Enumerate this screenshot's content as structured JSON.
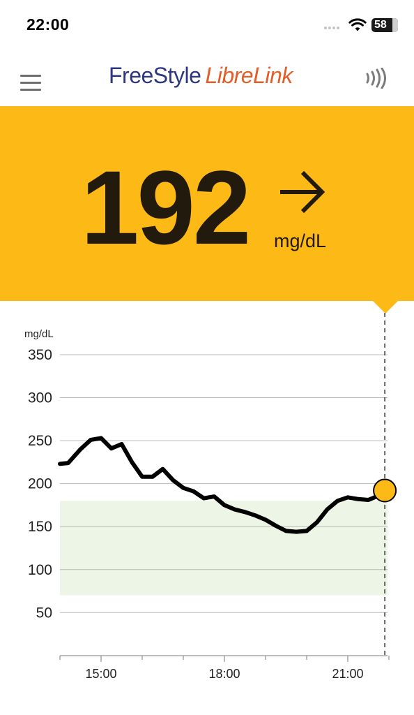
{
  "status_bar": {
    "time": "22:00",
    "battery": "58"
  },
  "header": {
    "brand_part1": "FreeStyle",
    "brand_part2": "LibreLink",
    "menu_icon": "hamburger-menu-icon",
    "scan_icon": "nfc-scan-icon"
  },
  "reading": {
    "value": "192",
    "unit": "mg/dL",
    "trend": "steady-right-arrow",
    "banner_color": "#fdb915"
  },
  "chart_data": {
    "type": "line",
    "ylabel": "mg/dL",
    "ylim": [
      0,
      350
    ],
    "y_ticks": [
      50,
      100,
      150,
      200,
      250,
      300,
      350
    ],
    "x_ticks": [
      "15:00",
      "18:00",
      "21:00"
    ],
    "x_range_hours": [
      14.0,
      22.0
    ],
    "target_range": [
      70,
      180
    ],
    "target_color": "#edf6e6",
    "line_color": "#000000",
    "current_point": {
      "x": 21.9,
      "y": 192,
      "color": "#fdb915"
    },
    "series": [
      {
        "x": [
          14.0,
          14.2,
          14.5,
          14.75,
          15.0,
          15.25,
          15.5,
          15.75,
          16.0,
          16.25,
          16.5,
          16.75,
          17.0,
          17.25,
          17.5,
          17.75,
          18.0,
          18.25,
          18.5,
          18.75,
          19.0,
          19.25,
          19.5,
          19.75,
          20.0,
          20.25,
          20.5,
          20.75,
          21.0,
          21.25,
          21.5,
          21.75,
          21.9
        ],
        "y": [
          223,
          224,
          240,
          251,
          253,
          241,
          246,
          225,
          208,
          208,
          217,
          204,
          195,
          191,
          183,
          185,
          175,
          170,
          167,
          163,
          158,
          151,
          145,
          144,
          145,
          155,
          170,
          180,
          184,
          182,
          181,
          186,
          192
        ]
      }
    ]
  }
}
